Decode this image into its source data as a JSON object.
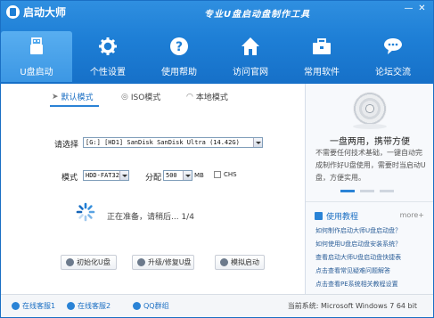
{
  "app": {
    "title": "启动大师",
    "slogan": "专业U盘启动盘制作工具"
  },
  "window_controls": [
    "—",
    "✕"
  ],
  "nav": [
    {
      "label": "U盘启动",
      "icon": "usb-icon",
      "active": true
    },
    {
      "label": "个性设置",
      "icon": "gear-icon",
      "active": false
    },
    {
      "label": "使用帮助",
      "icon": "help-icon",
      "active": false
    },
    {
      "label": "访问官网",
      "icon": "home-icon",
      "active": false
    },
    {
      "label": "常用软件",
      "icon": "briefcase-icon",
      "active": false
    },
    {
      "label": "论坛交流",
      "icon": "chat-icon",
      "active": false
    }
  ],
  "modes": {
    "default": "默认模式",
    "iso": "ISO模式",
    "local": "本地模式"
  },
  "form": {
    "device_label": "请选择",
    "device_value": "[G:] [HD1] SanDisk SanDisk Ultra (14.42G)",
    "mode_label": "模式",
    "mode_value": "HDD-FAT32",
    "partition_label": "分配",
    "partition_value": "500",
    "partition_unit": "MB",
    "chs_label": "CHS"
  },
  "status_text": "正在准备，请稍后... 1/4",
  "buttons": {
    "init": "初始化U盘",
    "upgrade": "升级/修复U盘",
    "simulate": "模拟启动"
  },
  "promo": {
    "title": "一盘两用，携带方便",
    "text": "不需要任何技术基础，一键自动完成制作好U盘使用，需要时当启动U盘，方便实用。"
  },
  "guide": {
    "title": "使用教程",
    "more": "more+",
    "items": [
      "如何制作启动大师U盘启动盘？",
      "如何使用U盘启动盘安装系统？",
      "查看启动大师U盘启动盘快捷表",
      "点击查看常见疑难问题解答",
      "点击查看PE系统相关教程设置"
    ]
  },
  "footer": {
    "service1": "在线客服1",
    "service2": "在线客服2",
    "qq": "QQ群组",
    "system": "当前系统: Microsoft Windows 7 64 bit"
  }
}
